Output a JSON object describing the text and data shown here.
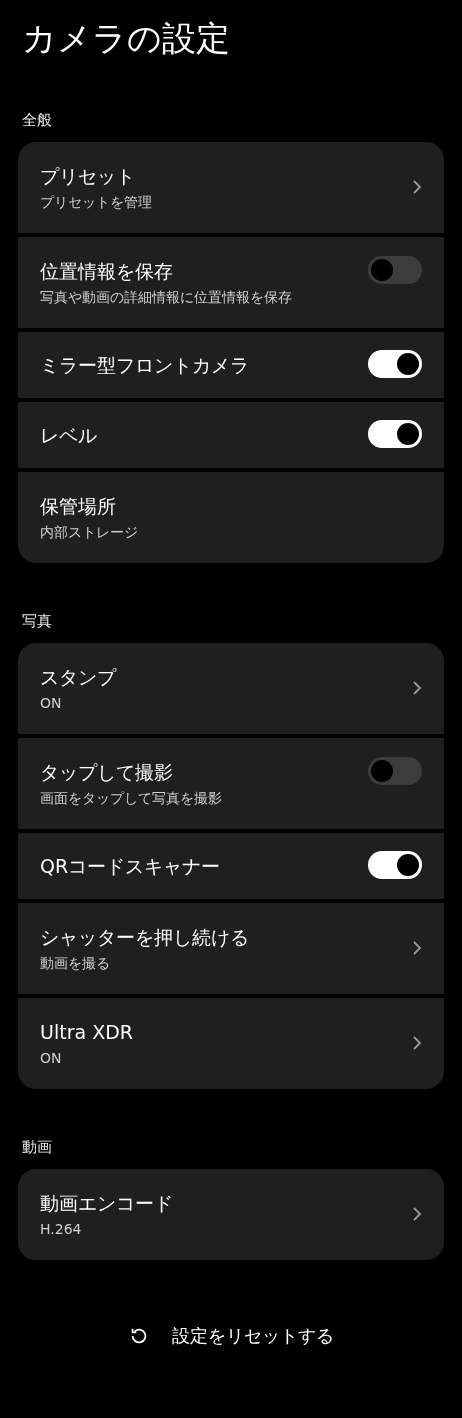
{
  "title": "カメラの設定",
  "sections": [
    {
      "label": "全般",
      "rows": [
        {
          "kind": "nav",
          "title": "プリセット",
          "subtitle": "プリセットを管理"
        },
        {
          "kind": "toggle",
          "title": "位置情報を保存",
          "subtitle": "写真や動画の詳細情報に位置情報を保存",
          "on": false
        },
        {
          "kind": "toggle",
          "title": "ミラー型フロントカメラ",
          "on": true
        },
        {
          "kind": "toggle",
          "title": "レベル",
          "on": true
        },
        {
          "kind": "plain",
          "title": "保管場所",
          "subtitle": "内部ストレージ"
        }
      ]
    },
    {
      "label": "写真",
      "rows": [
        {
          "kind": "nav",
          "title": "スタンプ",
          "subtitle": "ON"
        },
        {
          "kind": "toggle",
          "title": "タップして撮影",
          "subtitle": "画面をタップして写真を撮影",
          "on": false
        },
        {
          "kind": "toggle",
          "title": "QRコードスキャナー",
          "on": true
        },
        {
          "kind": "nav",
          "title": "シャッターを押し続ける",
          "subtitle": "動画を撮る"
        },
        {
          "kind": "nav",
          "title": "Ultra XDR",
          "subtitle": "ON"
        }
      ]
    },
    {
      "label": "動画",
      "rows": [
        {
          "kind": "nav",
          "title": "動画エンコード",
          "subtitle": "H.264"
        }
      ]
    }
  ],
  "reset_button": "設定をリセットする"
}
